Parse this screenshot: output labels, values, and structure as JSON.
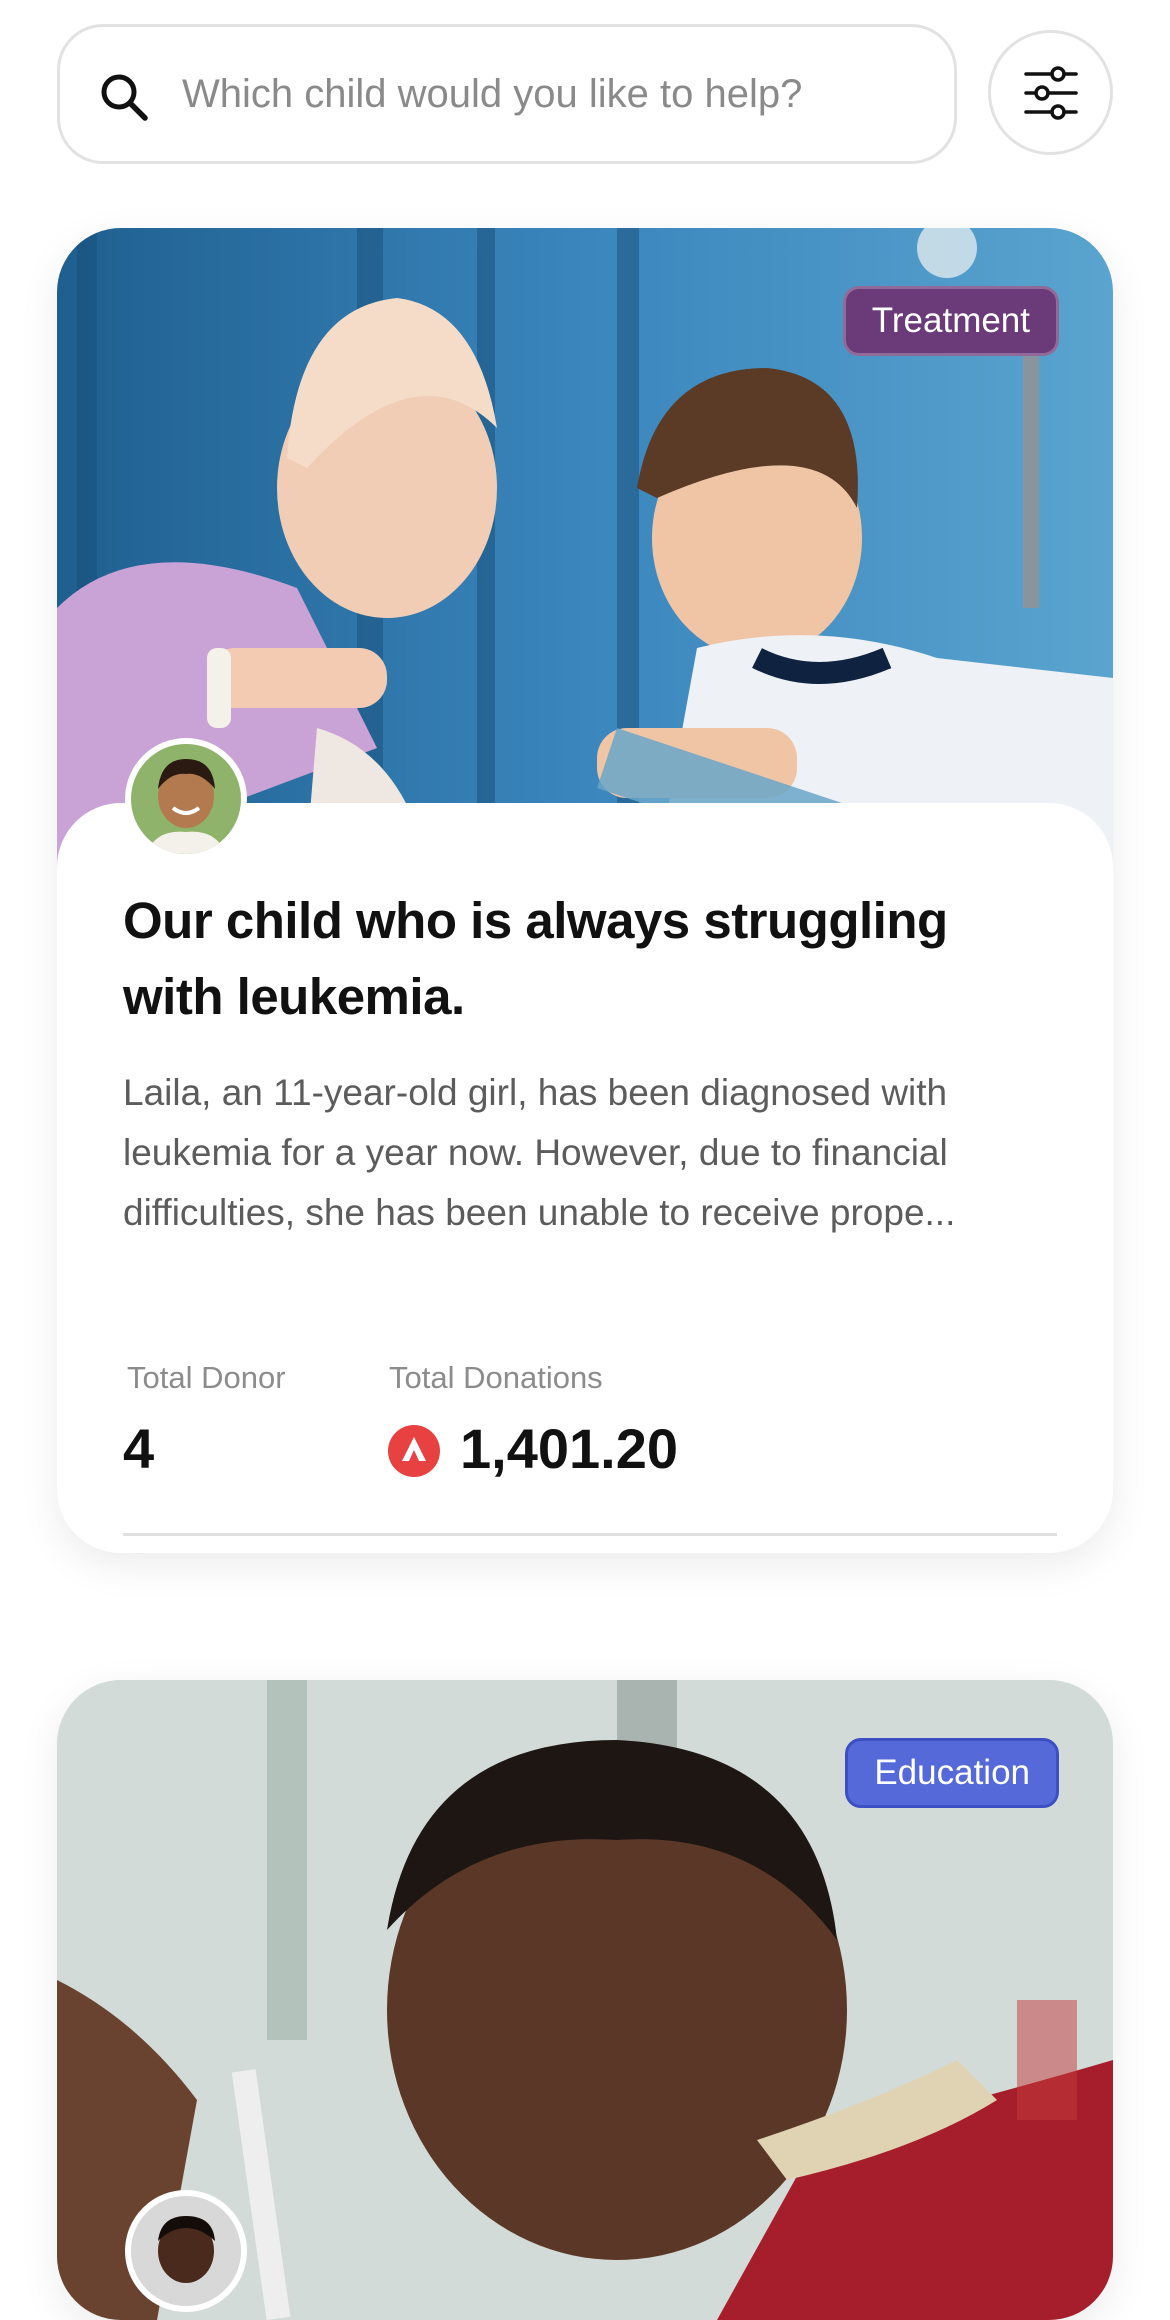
{
  "search": {
    "placeholder": "Which child would you like to help?",
    "icon": "search-icon"
  },
  "filter": {
    "icon": "sliders-icon"
  },
  "cards": [
    {
      "category": "Treatment",
      "category_color": "#6b3a78",
      "title": "Our child who is always struggling with leukemia.",
      "description": "Laila, an 11-year-old girl, has been diagnosed with leukemia for a year now. However, due to financial difficulties, she has been unable to receive prope...",
      "donor_label": "Total Donor",
      "donor_count": "4",
      "donations_label": "Total Donations",
      "donations_value": "1,401.20",
      "currency_icon": "avalanche-coin-icon",
      "currency_color": "#e84142"
    },
    {
      "category": "Education",
      "category_color": "#5569d8"
    }
  ]
}
